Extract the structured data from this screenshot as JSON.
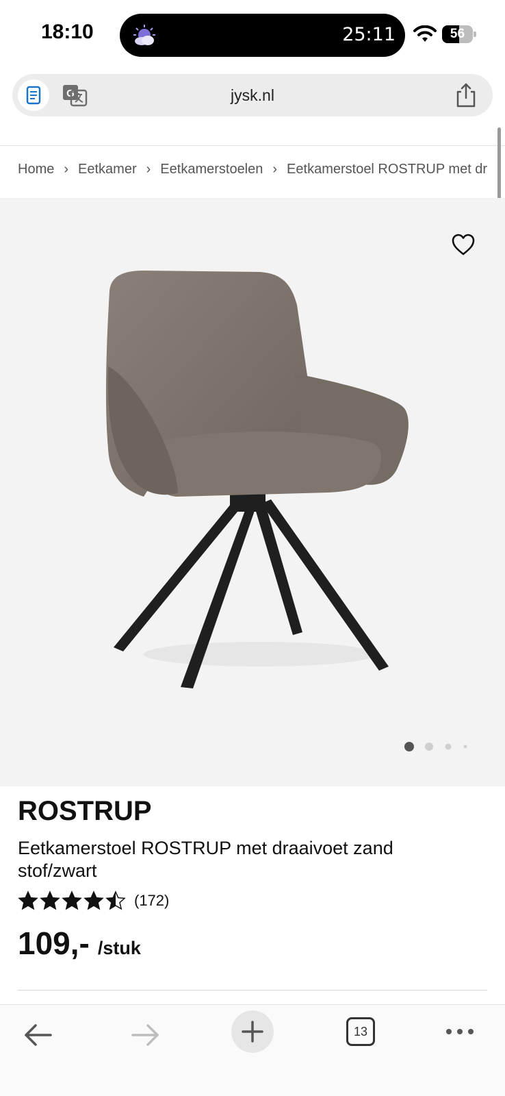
{
  "status_bar": {
    "time": "18:10",
    "timer": "25:11",
    "battery_level": "56",
    "battery_fraction": 0.56
  },
  "browser": {
    "url": "jysk.nl",
    "icons": {
      "reader": "reader-icon",
      "translate": "translate-icon",
      "share": "share-icon"
    }
  },
  "breadcrumb": {
    "items": [
      "Home",
      "Eetkamer",
      "Eetkamerstoelen",
      "Eetkamerstoel ROSTRUP met draaivoet zand stof/zwart"
    ],
    "separator": "›"
  },
  "product": {
    "name": "ROSTRUP",
    "description": "Eetkamerstoel ROSTRUP met draaivoet zand stof/zwart",
    "rating": 4.5,
    "rating_max": 5,
    "review_count": "(172)",
    "price": "109,-",
    "price_unit": "/stuk",
    "image_count": 4,
    "active_image": 1
  },
  "toolbar": {
    "tabs_count": "13",
    "icons": [
      "back-arrow-icon",
      "forward-arrow-icon",
      "plus-icon",
      "tabs-icon",
      "more-icon"
    ]
  },
  "colors": {
    "image_bg": "#f3f3f3",
    "text": "#111111",
    "chair_fabric": "#7d736b",
    "chair_legs": "#1f1f1f"
  }
}
